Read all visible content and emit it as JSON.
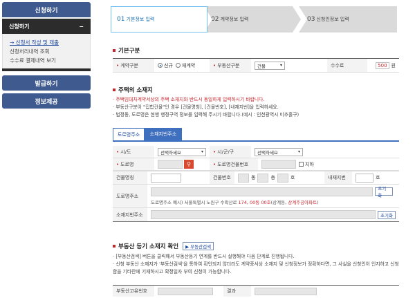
{
  "sidebar": {
    "top_label": "신청하기",
    "sub_label": "신청하기",
    "sub_toggle": "−",
    "items": [
      {
        "label": "→ 신청서 작성 및 제출"
      },
      {
        "label": "신청처리내역 조회"
      },
      {
        "label": "수수료 결제내역 보기"
      }
    ],
    "btn_issue": "발급하기",
    "btn_info": "정보제공"
  },
  "steps": [
    {
      "num": "01",
      "label": "기본정보 입력"
    },
    {
      "num": "02",
      "label": "계약정보 입력"
    },
    {
      "num": "03",
      "label": "신청인정보 입력"
    }
  ],
  "basic": {
    "title": "기본구분",
    "contract_label": "계약구분",
    "opt_new": "신규",
    "opt_renew": "재계약",
    "realty_label": "부동산구분",
    "realty_value": "건물",
    "fee_label": "수수료",
    "fee_value": "500",
    "fee_unit": "원"
  },
  "address": {
    "title": "주택의 소재지",
    "note1": "· 주택임대차계약서상의 주택 소재지와 반드시 동일하게 입력하시기 바랍니다.",
    "note2": "· 부동산구분이 \"집합건물\"인 경우 [건물명칭], [건물번호], [내재지번]을 입력하세요.",
    "note3": "· 법정동, 도로명은 현행 행정구역 정보를 입력해 주시기 바랍니다.(예시 : 인천광역시 미추홀구)",
    "tab_road": "도로명주소",
    "tab_lot": "소재지번주소",
    "sido_label": "시/도",
    "sido_value": "선택하세요",
    "sigungu_label": "시/군/구",
    "sigungu_value": "선택하세요",
    "road_label": "도로명",
    "road_no_label": "도로명건물번호",
    "basement_label": "지하",
    "bldg_name_label": "건물명칭",
    "bldg_no_label": "건물번호",
    "dong_unit": "동",
    "floor_unit": "층",
    "ho_unit": "호",
    "inner_lot_label": "내재지번",
    "inner_ho_unit": "호",
    "road_addr_label": "도로명주소",
    "road_addr_example_prefix": "도로명주소 예시) 서울특별시 노원구 수락산로 ",
    "road_addr_example_red1": "174, 00동 00호",
    "road_addr_example_mid": "(상계동, ",
    "road_addr_example_red2": "상계주공아파트",
    "road_addr_example_suffix": ")",
    "reset_btn": "초기화",
    "lot_addr_label": "소재지번주소",
    "reset_btn2": "초기화"
  },
  "registry": {
    "title": "부동산 등기 소재지 확인",
    "search_btn": "▶ 부동산검색",
    "note1": "· [부동산검색] 버튼을 클릭해서 부동산등기 연계를 반드시 실행해야 다음 단계로 진행됩니다.",
    "note2": "· 신청 부동산 소재지가 '부동산검색'을 통하여 확인되지 않더라도 계약증서상 소재지 및 신청정보가 정확하다면, 그 사실을 신청인이 인지하고 신청",
    "note3": "  함을 기타란에 기재하시고 확정일자 부여 신청이 가능합니다.",
    "uid_label": "부동산고유번호",
    "result_label": "결과"
  }
}
